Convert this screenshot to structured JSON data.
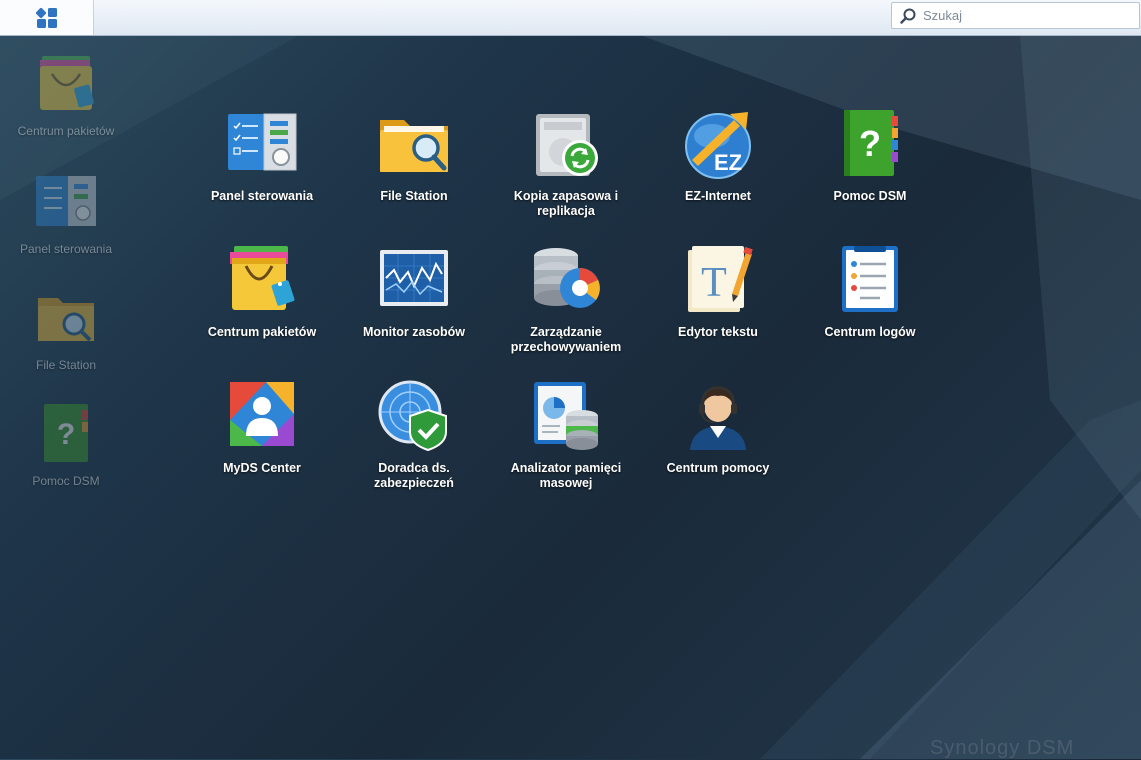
{
  "topbar": {
    "search_placeholder": "Szukaj"
  },
  "desktop_shortcuts": [
    {
      "label": "Centrum pakietów",
      "icon": "package-center-icon"
    },
    {
      "label": "Panel sterowania",
      "icon": "control-panel-icon"
    },
    {
      "label": "File Station",
      "icon": "file-station-icon"
    },
    {
      "label": "Pomoc DSM",
      "icon": "dsm-help-icon"
    }
  ],
  "main_menu": [
    {
      "label": "Panel sterowania",
      "icon": "control-panel-icon"
    },
    {
      "label": "File Station",
      "icon": "file-station-icon"
    },
    {
      "label": "Kopia zapasowa i replikacja",
      "icon": "backup-replication-icon"
    },
    {
      "label": "EZ-Internet",
      "icon": "ez-internet-icon"
    },
    {
      "label": "Pomoc DSM",
      "icon": "dsm-help-icon"
    },
    {
      "label": "Centrum pakietów",
      "icon": "package-center-icon"
    },
    {
      "label": "Monitor zasobów",
      "icon": "resource-monitor-icon"
    },
    {
      "label": "Zarządzanie przechowywaniem",
      "icon": "storage-manager-icon"
    },
    {
      "label": "Edytor tekstu",
      "icon": "text-editor-icon"
    },
    {
      "label": "Centrum logów",
      "icon": "log-center-icon"
    },
    {
      "label": "MyDS Center",
      "icon": "myds-center-icon"
    },
    {
      "label": "Doradca ds. zabezpieczeń",
      "icon": "security-advisor-icon"
    },
    {
      "label": "Analizator pamięci masowej",
      "icon": "storage-analyzer-icon"
    },
    {
      "label": "Centrum pomocy",
      "icon": "support-center-icon"
    }
  ],
  "brand_watermark": "Synology DSM"
}
